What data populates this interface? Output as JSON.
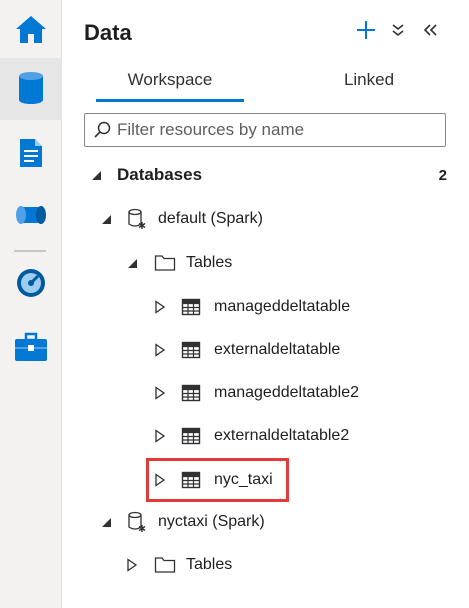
{
  "rail": {
    "items": [
      {
        "name": "home-icon"
      },
      {
        "name": "data-icon"
      },
      {
        "name": "develop-icon"
      },
      {
        "name": "integrate-icon"
      },
      {
        "name": "monitor-icon"
      },
      {
        "name": "manage-icon"
      }
    ],
    "active_index": 1
  },
  "panel": {
    "title": "Data",
    "actions": {
      "add": "plus-icon",
      "collapse_all": "double-chevron-down-icon",
      "hide": "double-chevron-left-icon"
    }
  },
  "tabs": [
    {
      "label": "Workspace",
      "active": true
    },
    {
      "label": "Linked",
      "active": false
    }
  ],
  "filter": {
    "placeholder": "Filter resources by name",
    "value": ""
  },
  "tree": {
    "section": {
      "label": "Databases",
      "count": "2"
    },
    "databases": [
      {
        "label": "default (Spark)",
        "expanded": true,
        "tables_folder": {
          "label": "Tables",
          "expanded": true,
          "items": [
            {
              "label": "manageddeltatable"
            },
            {
              "label": "externaldeltatable"
            },
            {
              "label": "manageddeltatable2"
            },
            {
              "label": "externaldeltatable2"
            },
            {
              "label": "nyc_taxi",
              "highlighted": true
            }
          ]
        }
      },
      {
        "label": "nyctaxi (Spark)",
        "expanded": true,
        "tables_folder": {
          "label": "Tables",
          "expanded": false
        }
      }
    ]
  },
  "colors": {
    "accent": "#0078d4",
    "highlight_border": "#e23b3b",
    "rail_background": "#f3f2f1"
  }
}
